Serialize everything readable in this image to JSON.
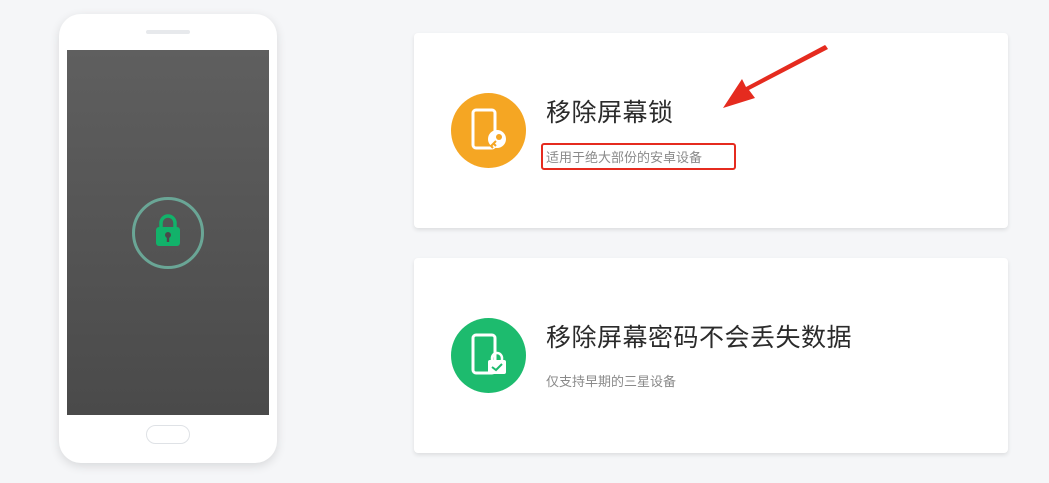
{
  "phone": {
    "screen_icon": "padlock-icon"
  },
  "options": [
    {
      "title": "移除屏幕锁",
      "subtitle": "适用于绝大部份的安卓设备",
      "icon": "phone-key-icon",
      "icon_color": "#f5a623"
    },
    {
      "title": "移除屏幕密码不会丢失数据",
      "subtitle": "仅支持早期的三星设备",
      "icon": "phone-lock-icon",
      "icon_color": "#1dbb6e"
    }
  ],
  "annotation": {
    "arrow_color": "#e52b1f",
    "highlight_color": "#e52b1f"
  }
}
